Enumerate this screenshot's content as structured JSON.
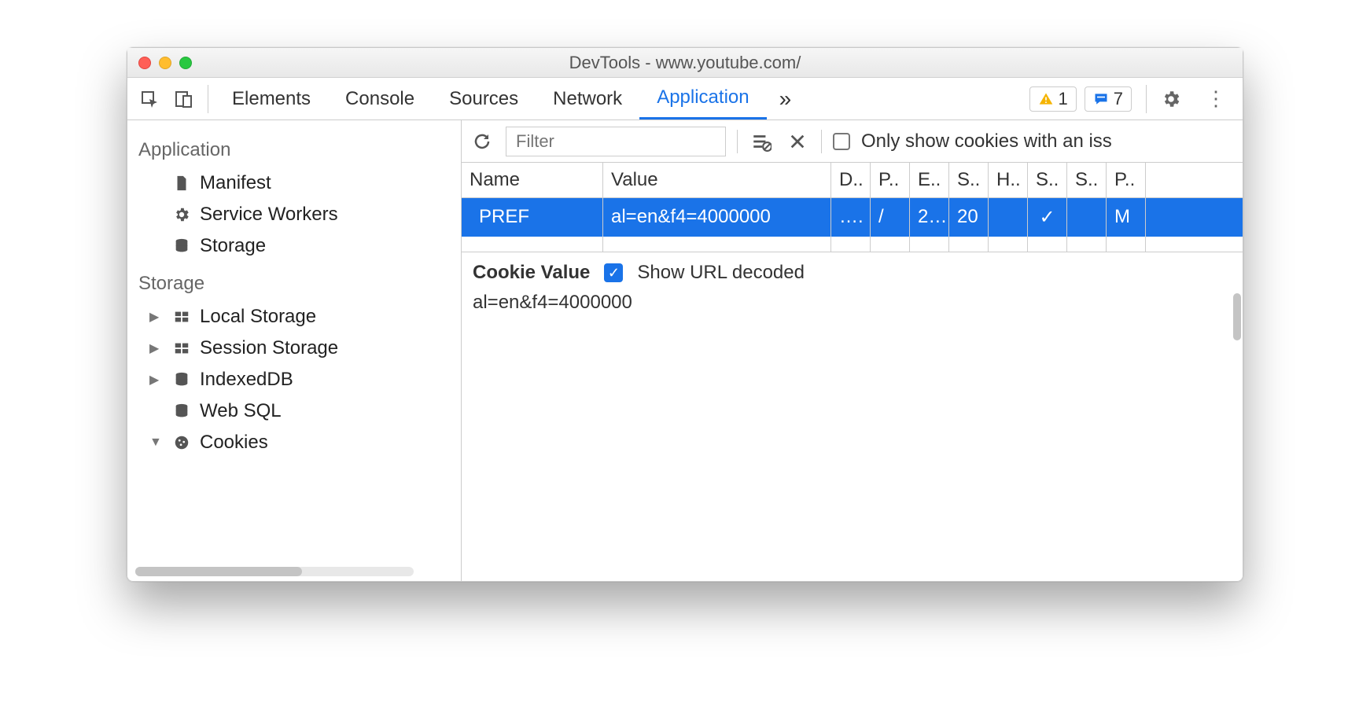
{
  "window": {
    "title": "DevTools - www.youtube.com/"
  },
  "tabs": {
    "items": [
      "Elements",
      "Console",
      "Sources",
      "Network",
      "Application"
    ],
    "active": "Application",
    "overflow": "»"
  },
  "warnings": {
    "count": "1"
  },
  "messages": {
    "count": "7"
  },
  "sidebar": {
    "sections": [
      {
        "title": "Application",
        "items": [
          {
            "label": "Manifest",
            "icon": "file-icon",
            "arrow": ""
          },
          {
            "label": "Service Workers",
            "icon": "gear-icon",
            "arrow": ""
          },
          {
            "label": "Storage",
            "icon": "database-icon",
            "arrow": ""
          }
        ]
      },
      {
        "title": "Storage",
        "items": [
          {
            "label": "Local Storage",
            "icon": "grid-icon",
            "arrow": "▶"
          },
          {
            "label": "Session Storage",
            "icon": "grid-icon",
            "arrow": "▶"
          },
          {
            "label": "IndexedDB",
            "icon": "database-icon",
            "arrow": "▶"
          },
          {
            "label": "Web SQL",
            "icon": "database-icon",
            "arrow": ""
          },
          {
            "label": "Cookies",
            "icon": "cookie-icon",
            "arrow": "▼"
          }
        ]
      }
    ]
  },
  "filter": {
    "placeholder": "Filter",
    "only_label": "Only show cookies with an iss"
  },
  "table": {
    "headers": [
      "Name",
      "Value",
      "D..",
      "P..",
      "E..",
      "S..",
      "H..",
      "S..",
      "S..",
      "P.."
    ],
    "row": {
      "name": "PREF",
      "value": "al=en&f4=4000000",
      "c2": "….",
      "c3": "/",
      "c4": "2…",
      "c5": "20",
      "c6": "",
      "c7": "✓",
      "c8": "",
      "c9": "M"
    }
  },
  "detail": {
    "label": "Cookie Value",
    "decoded_label": "Show URL decoded",
    "value": "al=en&f4=4000000"
  }
}
